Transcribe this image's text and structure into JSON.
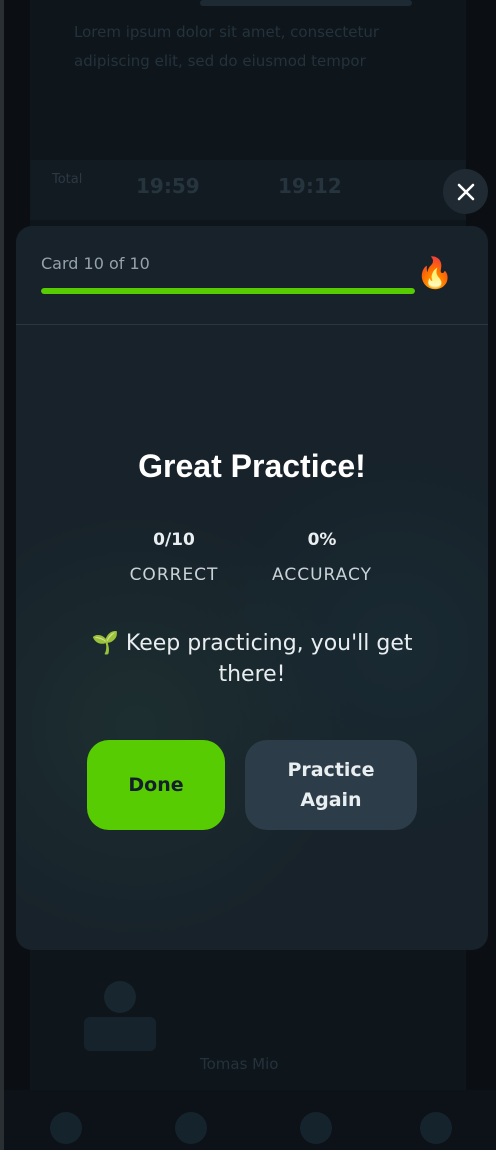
{
  "background": {
    "text": "Lorem ipsum dolor sit amet, consectetur adipiscing elit, sed do eiusmod tempor",
    "stat_label": "Total",
    "stat_a": "19:59",
    "stat_b": "19:12",
    "user_name": "Tomas Mio"
  },
  "progress": {
    "card_label": "Card 10 of 10",
    "fraction": 1.0,
    "streak_icon": "🔥"
  },
  "results": {
    "title": "Great Practice!",
    "correct_value": "0/10",
    "correct_label": "CORRECT",
    "accuracy_value": "0%",
    "accuracy_label": "ACCURACY",
    "message": "🌱 Keep practicing, you'll get there!"
  },
  "actions": {
    "done_label": "Done",
    "practice_again_label": "Practice Again"
  },
  "colors": {
    "accent": "#58cc02",
    "modal_bg": "#17222a",
    "secondary_button": "#2c3c48"
  },
  "icons": {
    "close": "close-icon",
    "streak": "flame-icon"
  }
}
